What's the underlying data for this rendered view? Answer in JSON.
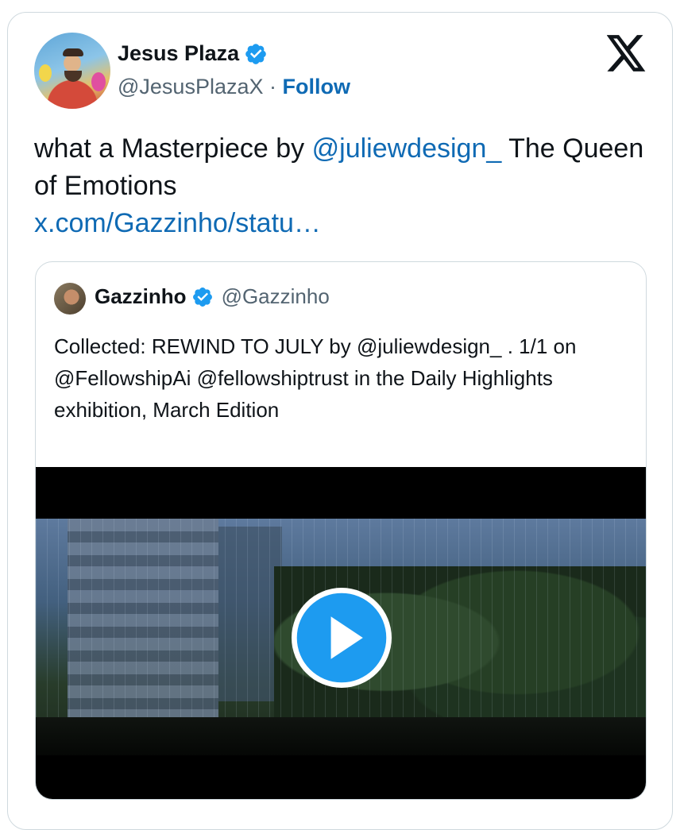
{
  "tweet": {
    "author": {
      "name": "Jesus Plaza",
      "handle": "@JesusPlazaX",
      "separator": "·",
      "follow_label": "Follow",
      "verified": true
    },
    "text": {
      "part1": "what a Masterpiece by ",
      "mention": "@juliewdesign_",
      "part2": " The Queen of Emotions",
      "link": "x.com/Gazzinho/statu…"
    },
    "quoted": {
      "name": "Gazzinho",
      "handle": "@Gazzinho",
      "verified": true,
      "text": "Collected: REWIND TO JULY by @juliewdesign_ . 1/1 on @FellowshipAi @fellowshiptrust in the Daily Highlights exhibition, March Edition",
      "media": {
        "type": "video",
        "icon": "play-icon"
      }
    }
  },
  "icons": {
    "logo": "x-logo-icon",
    "verified": "verified-badge-icon",
    "play": "play-icon"
  },
  "colors": {
    "link": "#0f6ab4",
    "verified": "#1d9bf0",
    "text": "#0f1419",
    "secondary": "#536471",
    "border": "#cfd9de"
  }
}
